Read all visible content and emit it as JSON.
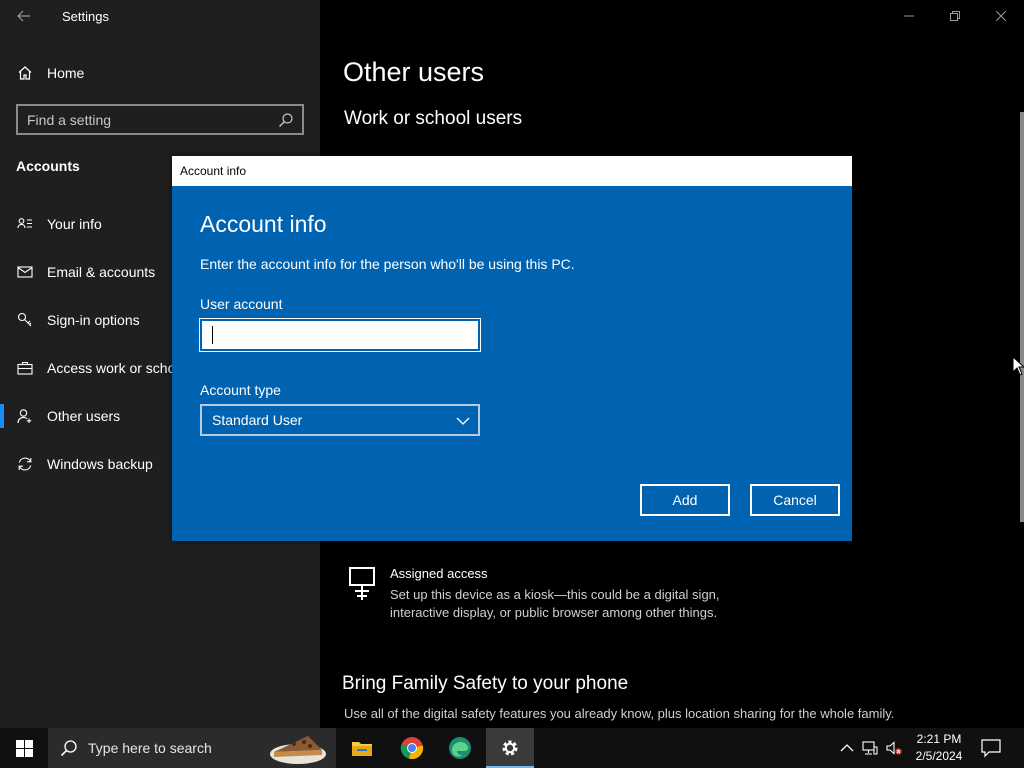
{
  "window": {
    "app_title": "Settings"
  },
  "sidebar": {
    "home_label": "Home",
    "search_placeholder": "Find a setting",
    "section": "Accounts",
    "items": [
      {
        "label": "Your info",
        "icon": "person-card-icon"
      },
      {
        "label": "Email & accounts",
        "icon": "mail-icon"
      },
      {
        "label": "Sign-in options",
        "icon": "key-icon"
      },
      {
        "label": "Access work or school",
        "icon": "briefcase-icon"
      },
      {
        "label": "Other users",
        "icon": "person-add-icon",
        "selected": true
      },
      {
        "label": "Windows backup",
        "icon": "sync-icon"
      }
    ]
  },
  "main": {
    "title": "Other users",
    "subtitle": "Work or school users",
    "assigned_access": {
      "title": "Assigned access",
      "desc": "Set up this device as a kiosk—this could be a digital sign, interactive display, or public browser among other things."
    },
    "family": {
      "title": "Bring Family Safety to your phone",
      "desc": "Use all of the digital safety features you already know, plus location sharing for the whole family."
    }
  },
  "dialog": {
    "window_title": "Account info",
    "heading": "Account info",
    "description": "Enter the account info for the person who'll be using this PC.",
    "user_account_label": "User account",
    "user_account_value": "",
    "account_type_label": "Account type",
    "account_type_value": "Standard User",
    "add_label": "Add",
    "cancel_label": "Cancel"
  },
  "taskbar": {
    "search_text": "Type here to search",
    "time": "2:21 PM",
    "date": "2/5/2024"
  },
  "colors": {
    "dialog_bg": "#0063b1",
    "accent": "#1a8cff",
    "sidebar_bg": "#1f1f1f"
  }
}
